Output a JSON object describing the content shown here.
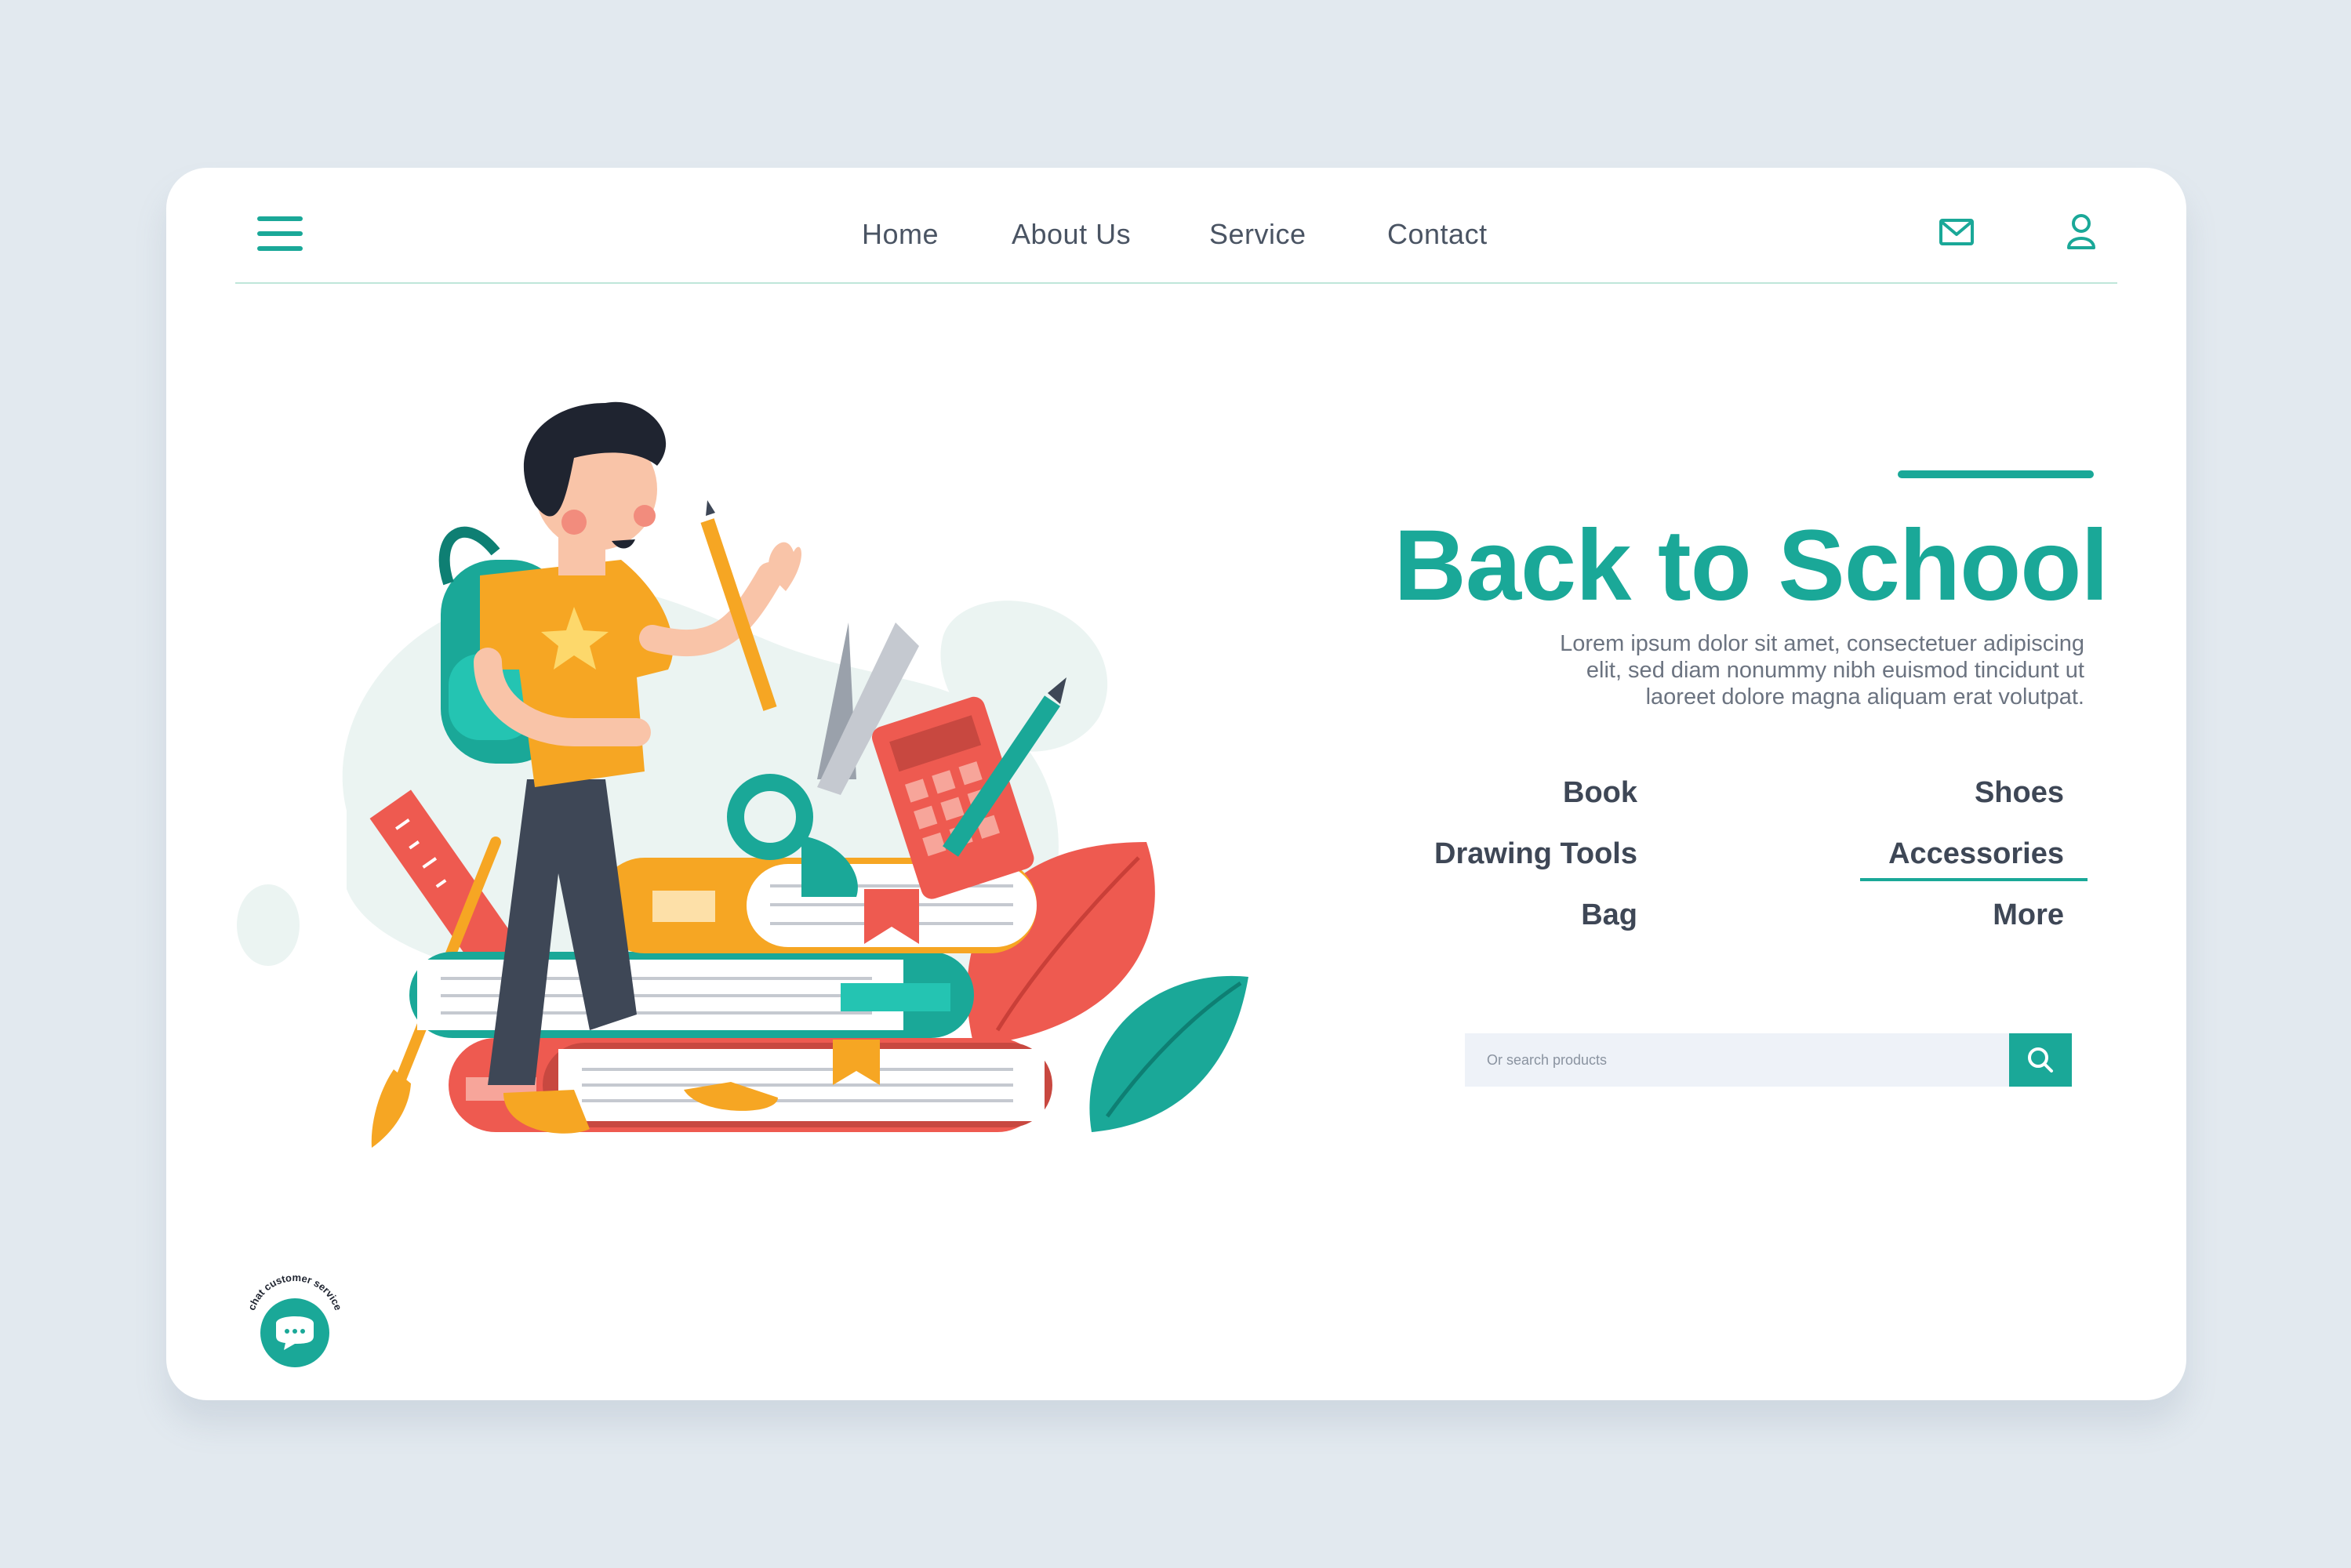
{
  "header": {
    "nav": [
      "Home",
      "About Us",
      "Service",
      "Contact"
    ],
    "icons": [
      "menu-icon",
      "mail-icon",
      "user-icon"
    ]
  },
  "hero": {
    "title": "Back to School",
    "description": "Lorem ipsum dolor sit amet, consectetuer adipiscing elit, sed diam nonummy nibh euismod tincidunt ut laoreet dolore magna aliquam erat volutpat."
  },
  "categories": {
    "left": [
      "Book",
      "Drawing Tools",
      "Bag"
    ],
    "right": [
      "Shoes",
      "Accessories",
      "More"
    ],
    "active": "Accessories"
  },
  "search": {
    "placeholder": "Or search products",
    "icon": "search-icon"
  },
  "chat": {
    "label": "chat customer service",
    "icon": "chat-bubble-icon"
  },
  "colors": {
    "accent": "#1aa898",
    "text": "#3e4756",
    "background": "#e2e9ef"
  }
}
